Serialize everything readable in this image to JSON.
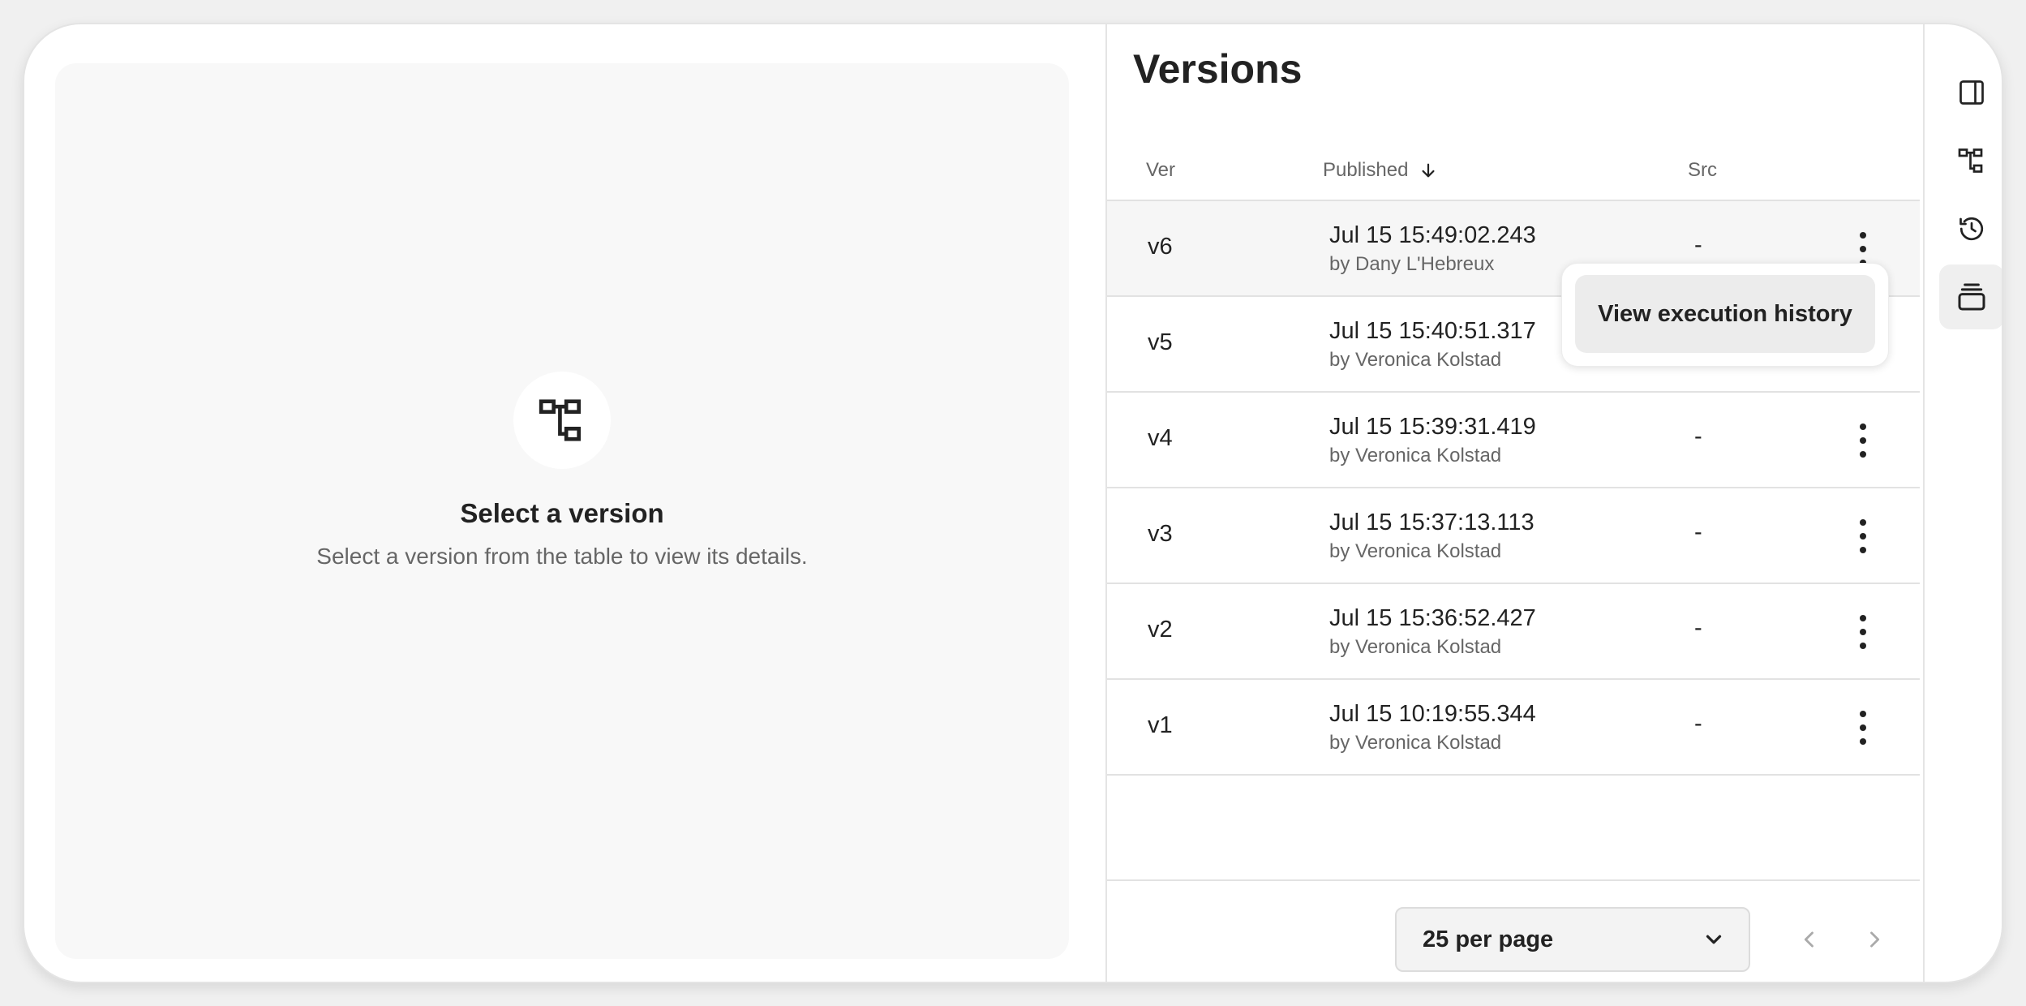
{
  "empty_state": {
    "title": "Select a version",
    "subtitle": "Select a version from the table to view its details.",
    "icon": "workflow-tree-icon"
  },
  "versions": {
    "title": "Versions",
    "columns": {
      "ver": "Ver",
      "published": "Published",
      "src": "Src"
    },
    "sort_icon": "arrow-down-icon",
    "rows": [
      {
        "ver": "v6",
        "date": "Jul 15 15:49:02.243",
        "by": "by Dany L'Hebreux",
        "src": "-"
      },
      {
        "ver": "v5",
        "date": "Jul 15 15:40:51.317",
        "by": "by Veronica Kolstad",
        "src": "-"
      },
      {
        "ver": "v4",
        "date": "Jul 15 15:39:31.419",
        "by": "by Veronica Kolstad",
        "src": "-"
      },
      {
        "ver": "v3",
        "date": "Jul 15 15:37:13.113",
        "by": "by Veronica Kolstad",
        "src": "-"
      },
      {
        "ver": "v2",
        "date": "Jul 15 15:36:52.427",
        "by": "by Veronica Kolstad",
        "src": "-"
      },
      {
        "ver": "v1",
        "date": "Jul 15 10:19:55.344",
        "by": "by Veronica Kolstad",
        "src": "-"
      }
    ],
    "menu": {
      "item": "View execution history"
    },
    "pagination": {
      "per_page": "25 per page"
    }
  },
  "rail": {
    "icons": [
      "side-panel-icon",
      "workflow-tree-icon",
      "history-icon",
      "versions-stack-icon"
    ],
    "active": "versions-stack-icon"
  },
  "colors": {
    "text": "#222222",
    "muted": "#666666",
    "panel_bg": "#f8f8f8",
    "hover_row": "#f6f6f6"
  }
}
